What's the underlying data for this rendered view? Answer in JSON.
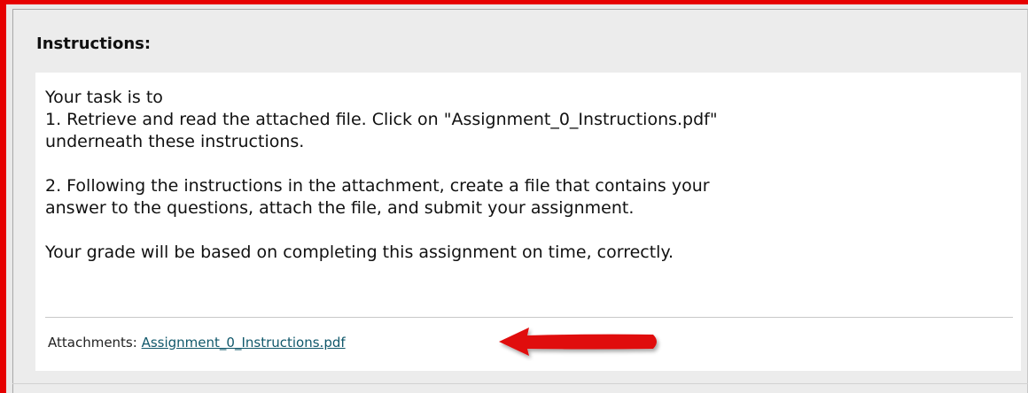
{
  "instructions": {
    "heading": "Instructions:",
    "lines": {
      "intro": "Your task is to",
      "step1_a": "1. Retrieve and read the attached file. Click on \"Assignment_0_Instructions.pdf\"",
      "step1_b": "underneath these instructions.",
      "step2_a": "2. Following the instructions in the attachment, create a file that contains your",
      "step2_b": "answer to the questions, attach the file, and submit your assignment.",
      "grade": "Your grade will be based on completing this assignment on time, correctly."
    },
    "attachments_label": "Attachments:",
    "attachment_link": "Assignment_0_Instructions.pdf"
  },
  "colors": {
    "highlight_border": "#e60000",
    "arrow": "#e01010",
    "link": "#11586b"
  }
}
